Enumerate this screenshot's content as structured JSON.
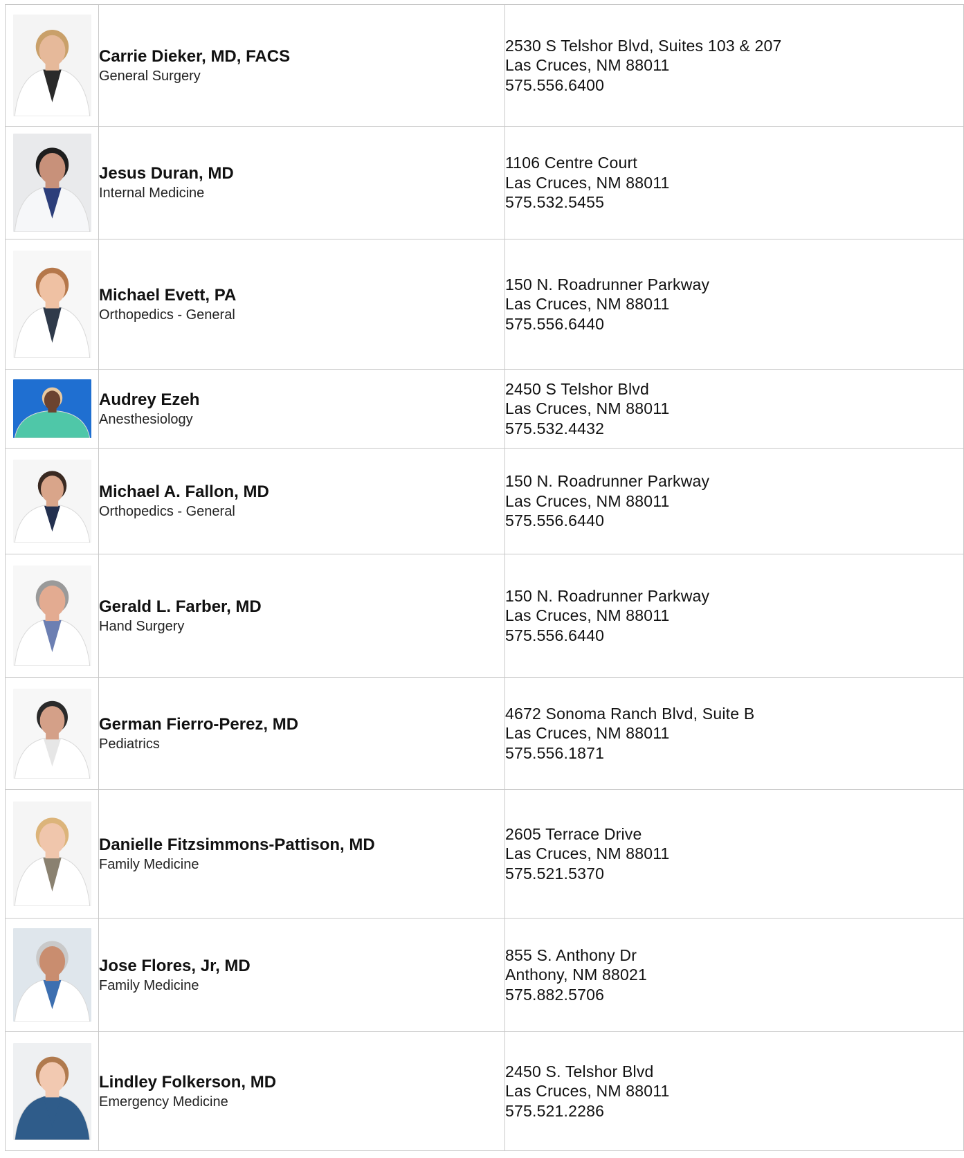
{
  "providers": [
    {
      "name": "Carrie Dieker, MD, FACS",
      "specialty": "General Surgery",
      "address_line1": "2530 S Telshor Blvd, Suites 103 & 207",
      "address_line2": "Las Cruces, NM 88011",
      "phone": "575.556.6400",
      "photo": {
        "bg": "#f4f4f4",
        "hair": "#c9a06a",
        "skin": "#e6b99a",
        "coat": "#ffffff",
        "shirt": "#2a2a2a"
      }
    },
    {
      "name": "Jesus Duran, MD",
      "specialty": "Internal Medicine",
      "address_line1": "1106 Centre Court",
      "address_line2": "Las Cruces, NM 88011",
      "phone": "575.532.5455",
      "photo": {
        "bg": "#e9eaec",
        "hair": "#1e1e1e",
        "skin": "#c8917a",
        "coat": "#f6f7f9",
        "shirt": "#2c3e7a"
      }
    },
    {
      "name": "Michael Evett, PA",
      "specialty": "Orthopedics - General",
      "address_line1": "150 N. Roadrunner Parkway",
      "address_line2": "Las Cruces, NM 88011",
      "phone": "575.556.6440",
      "photo": {
        "bg": "#f7f7f7",
        "hair": "#b5774a",
        "skin": "#efc1a3",
        "coat": "#ffffff",
        "shirt": "#2f3a4a"
      }
    },
    {
      "name": "Audrey Ezeh",
      "specialty": "Anesthesiology",
      "address_line1": "2450 S Telshor Blvd",
      "address_line2": "Las Cruces, NM 88011",
      "phone": "575.532.4432",
      "photo": {
        "bg": "#1f6fd1",
        "hair": "#e8c9a0",
        "skin": "#6b4330",
        "coat": "#4fc7a8",
        "shirt": "#4fc7a8"
      }
    },
    {
      "name": "Michael A. Fallon, MD",
      "specialty": "Orthopedics - General",
      "address_line1": "150 N. Roadrunner Parkway",
      "address_line2": "Las Cruces, NM 88011",
      "phone": "575.556.6440",
      "photo": {
        "bg": "#f6f6f6",
        "hair": "#3a2a22",
        "skin": "#d9a58a",
        "coat": "#ffffff",
        "shirt": "#23304f"
      }
    },
    {
      "name": "Gerald L. Farber, MD",
      "specialty": "Hand Surgery",
      "address_line1": "150 N. Roadrunner Parkway",
      "address_line2": "Las Cruces, NM 88011",
      "phone": "575.556.6440",
      "photo": {
        "bg": "#f7f7f7",
        "hair": "#9a9a9a",
        "skin": "#e3ab91",
        "coat": "#ffffff",
        "shirt": "#6c7fb2"
      }
    },
    {
      "name": "German Fierro-Perez, MD",
      "specialty": "Pediatrics",
      "address_line1": "4672 Sonoma Ranch Blvd, Suite B",
      "address_line2": "Las Cruces, NM 88011",
      "phone": "575.556.1871",
      "photo": {
        "bg": "#f7f7f7",
        "hair": "#2a2a2a",
        "skin": "#d4a088",
        "coat": "#ffffff",
        "shirt": "#e6e6e6"
      }
    },
    {
      "name": "Danielle Fitzsimmons-Pattison, MD",
      "specialty": "Family Medicine",
      "address_line1": "2605 Terrace Drive",
      "address_line2": "Las Cruces, NM 88011",
      "phone": "575.521.5370",
      "photo": {
        "bg": "#f5f5f5",
        "hair": "#dcb47a",
        "skin": "#f0c6ac",
        "coat": "#ffffff",
        "shirt": "#8a8170"
      }
    },
    {
      "name": "Jose Flores, Jr, MD",
      "specialty": "Family Medicine",
      "address_line1": "855 S. Anthony Dr",
      "address_line2": "Anthony, NM 88021",
      "phone": "575.882.5706",
      "photo": {
        "bg": "#dfe6ec",
        "hair": "#c9c9c9",
        "skin": "#c98d6f",
        "coat": "#ffffff",
        "shirt": "#3d6fb0"
      }
    },
    {
      "name": "Lindley Folkerson, MD",
      "specialty": "Emergency Medicine",
      "address_line1": "2450 S. Telshor Blvd",
      "address_line2": "Las Cruces, NM 88011",
      "phone": "575.521.2286",
      "photo": {
        "bg": "#eef0f2",
        "hair": "#b07a4e",
        "skin": "#f2c9b1",
        "coat": "#2f5c8a",
        "shirt": "#2f5c8a"
      }
    }
  ]
}
